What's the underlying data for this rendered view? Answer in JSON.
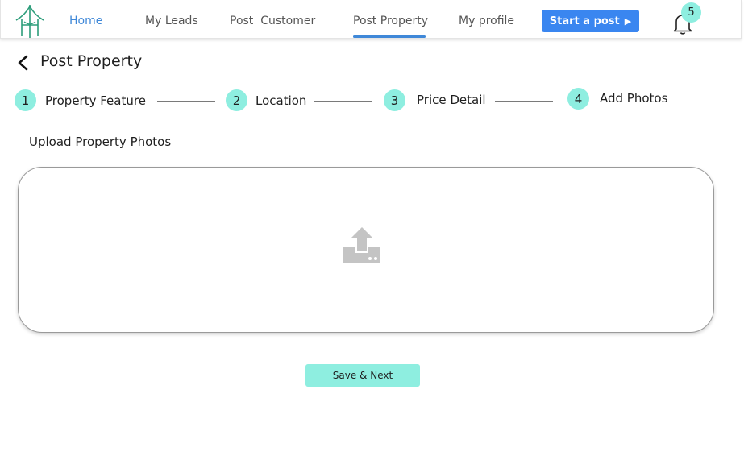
{
  "nav": {
    "items": [
      {
        "label": "Home"
      },
      {
        "label": "My Leads"
      },
      {
        "label": "Post  Customer"
      },
      {
        "label": "Post Property"
      },
      {
        "label": "My profile"
      }
    ],
    "active": "Post Property",
    "start_post_label": "Start a post",
    "notification_count": "5"
  },
  "page": {
    "title": "Post Property"
  },
  "steps": [
    {
      "number": "1",
      "label": "Property Feature"
    },
    {
      "number": "2",
      "label": "Location"
    },
    {
      "number": "3",
      "label": "Price Detail"
    },
    {
      "number": "4",
      "label": "Add Photos"
    }
  ],
  "upload": {
    "label": "Upload Property Photos"
  },
  "actions": {
    "save_next_label": "Save & Next"
  },
  "icons": {
    "logo": "house-logo-icon",
    "back": "chevron-left-icon",
    "bell": "bell-icon",
    "play": "play-triangle-icon",
    "upload": "upload-icon"
  },
  "colors": {
    "accent_blue": "#3a86f0",
    "nav_active": "#3f88d8",
    "step_teal": "#8eeee0",
    "upload_icon_gray": "#c4c4c4"
  }
}
